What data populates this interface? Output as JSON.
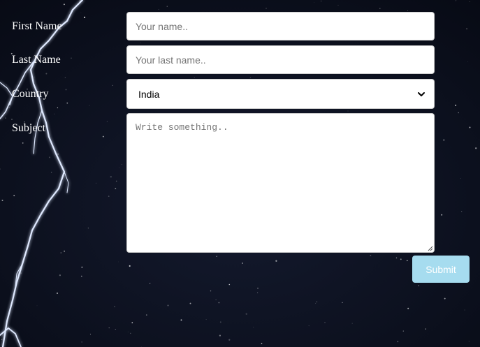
{
  "form": {
    "first_name": {
      "label": "First Name",
      "value": "",
      "placeholder": "Your name.."
    },
    "last_name": {
      "label": "Last Name",
      "value": "",
      "placeholder": "Your last name.."
    },
    "country": {
      "label": "Country",
      "selected": "India"
    },
    "subject": {
      "label": "Subject",
      "value": "",
      "placeholder": "Write something.."
    },
    "submit_label": "Submit"
  },
  "colors": {
    "background": "#0b1020",
    "submit_button": "#a6dcef",
    "label_text": "#ffffff"
  },
  "icons": {
    "select_arrow": "chevron-down-icon",
    "resize_grip": "resize-grip-icon"
  }
}
